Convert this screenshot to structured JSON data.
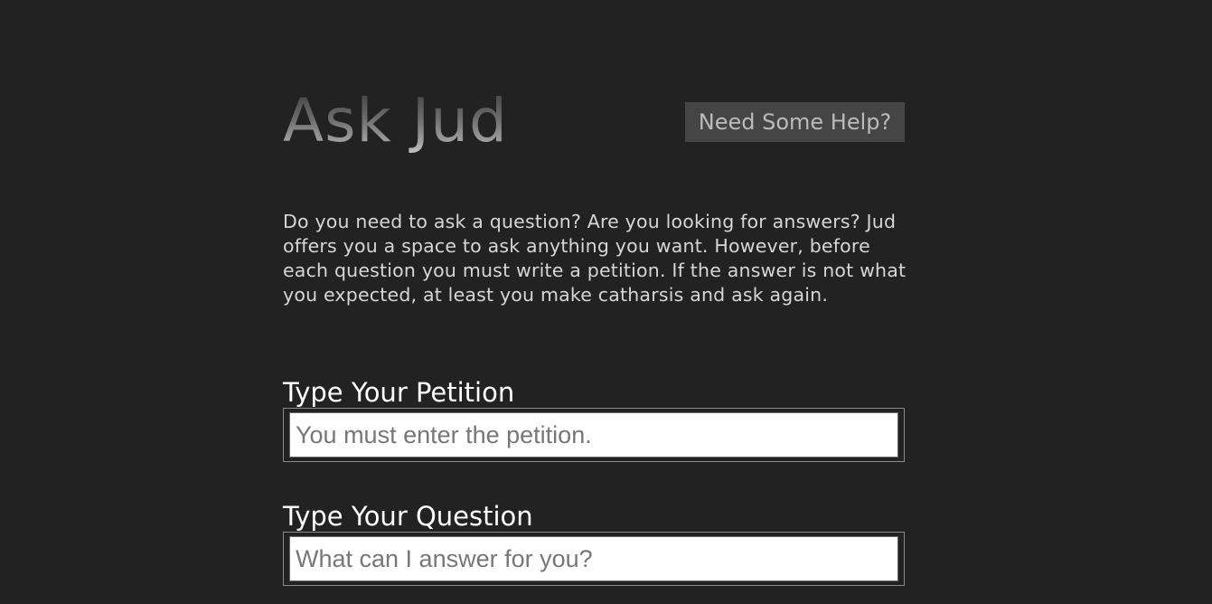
{
  "header": {
    "title": "Ask Jud",
    "help_label": "Need Some Help?"
  },
  "intro": {
    "text": "Do you need to ask a question? Are you looking for answers? Jud offers you a space to ask anything you want. However, before each question you must write a petition. If the answer is not what you expected, at least you make catharsis and ask again."
  },
  "form": {
    "petition": {
      "label": "Type Your Petition",
      "placeholder": "You must enter the petition.",
      "value": ""
    },
    "question": {
      "label": "Type Your Question",
      "placeholder": "What can I answer for you?",
      "value": ""
    }
  },
  "colors": {
    "background": "#222222",
    "help_button_bg": "#454545",
    "label_text": "#ffffff",
    "body_text": "#d6d6d6"
  }
}
